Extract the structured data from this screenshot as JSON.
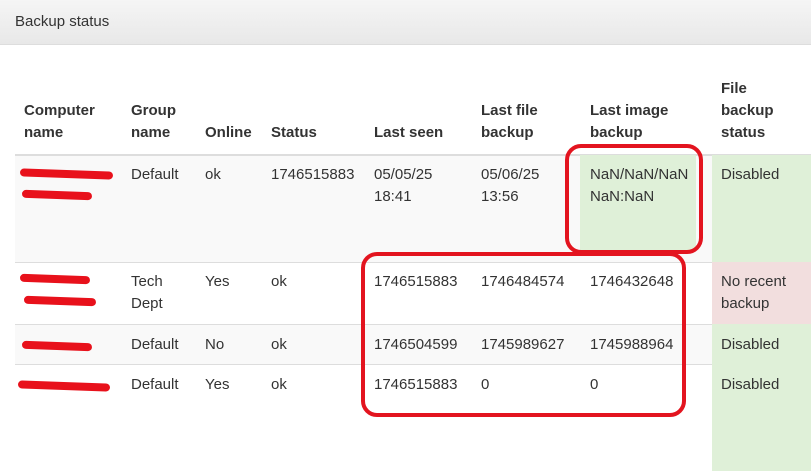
{
  "panel": {
    "title": "Backup status"
  },
  "table": {
    "headers": {
      "computer_name": [
        "Computer",
        "name"
      ],
      "group_name": [
        "Group",
        "name"
      ],
      "online": "Online",
      "status": "Status",
      "last_seen": "Last seen",
      "last_file_backup": [
        "Last file",
        "backup"
      ],
      "last_image_backup": [
        "Last image",
        "backup"
      ],
      "file_backup_status": [
        "File",
        "backup",
        "status"
      ]
    },
    "rows": [
      {
        "group": "Default",
        "online": "ok",
        "status": "1746515883",
        "last_seen": [
          "05/05/25",
          "18:41"
        ],
        "last_file_backup": [
          "05/06/25",
          "13:56"
        ],
        "last_image_backup": [
          "NaN/NaN/NaN",
          "NaN:NaN"
        ],
        "file_backup_status": "Disabled"
      },
      {
        "group": [
          "Tech",
          "Dept"
        ],
        "online": "Yes",
        "status": "ok",
        "last_seen": "1746515883",
        "last_file_backup": "1746484574",
        "last_image_backup": "1746432648",
        "file_backup_status": [
          "No recent",
          "backup"
        ]
      },
      {
        "group": "Default",
        "online": "No",
        "status": "ok",
        "last_seen": "1746504599",
        "last_file_backup": "1745989627",
        "last_image_backup": "1745988964",
        "file_backup_status": "Disabled"
      },
      {
        "group": "Default",
        "online": "Yes",
        "status": "ok",
        "last_seen": "1746515883",
        "last_file_backup": "0",
        "last_image_backup": "0",
        "file_backup_status": "Disabled"
      }
    ]
  },
  "colors": {
    "success_cell": "#dff0d8",
    "danger_cell": "#f2dede",
    "annotation_red": "#e3141f"
  }
}
